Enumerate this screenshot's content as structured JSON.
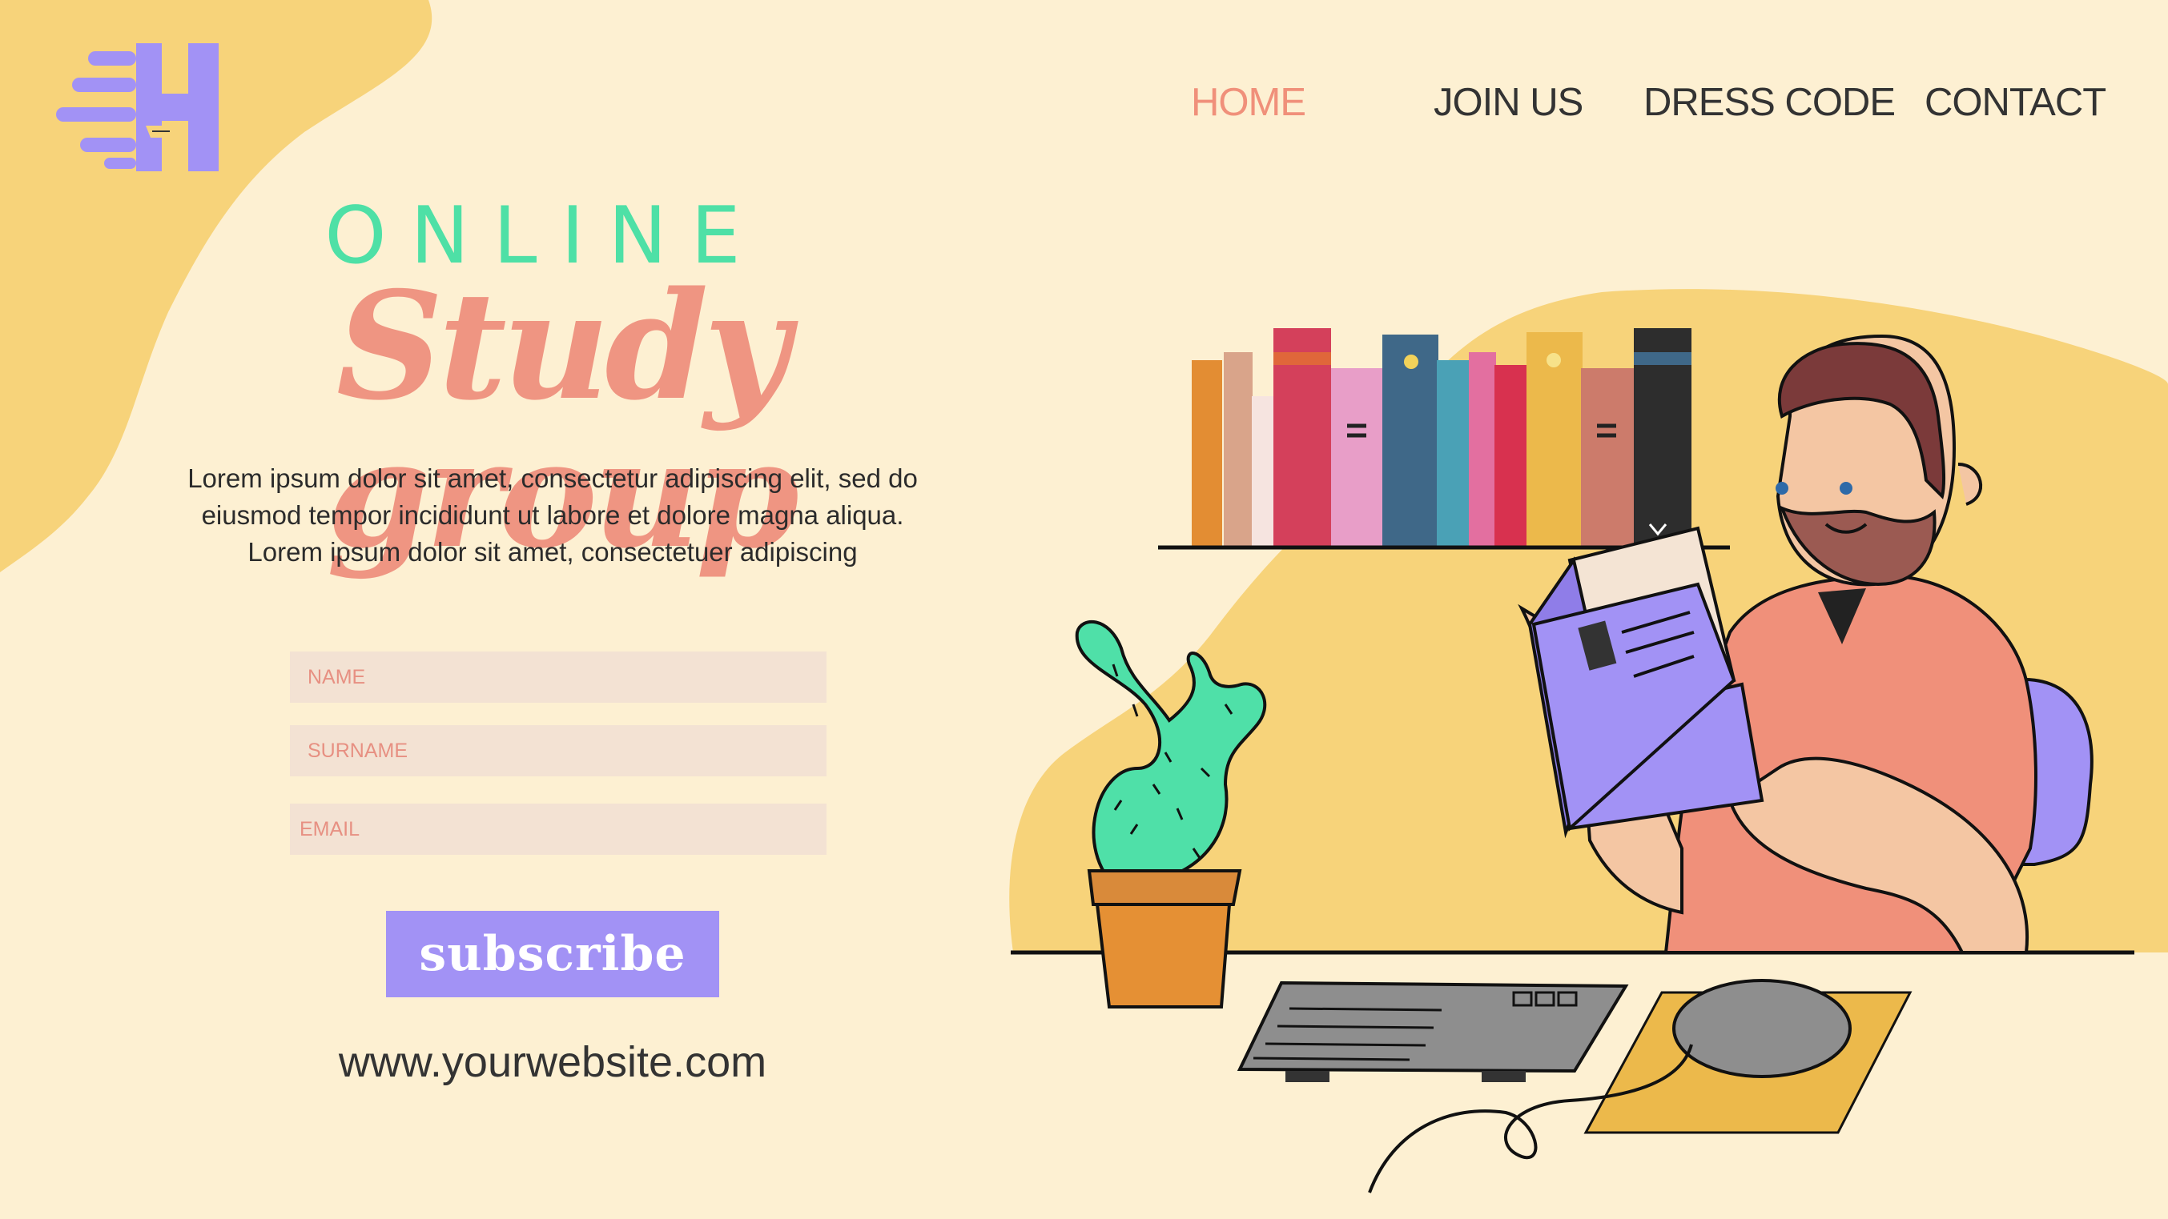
{
  "brand": {
    "logo_letter": "H",
    "logo_color": "#a292f5"
  },
  "nav": {
    "items": [
      {
        "label": "HOME",
        "active": true
      },
      {
        "label": "JOIN US",
        "active": false
      },
      {
        "label": "DRESS CODE",
        "active": false
      },
      {
        "label": "CONTACT",
        "active": false
      }
    ]
  },
  "hero": {
    "kicker": "ONLINE",
    "title": "Study group",
    "description": "Lorem ipsum dolor sit amet, consectetur adipiscing elit, sed do eiusmod tempor incididunt ut labore et dolore magna aliqua. Lorem ipsum dolor sit amet, consectetuer adipiscing"
  },
  "form": {
    "name_placeholder": "NAME",
    "surname_placeholder": "SURNAME",
    "email_placeholder": "EMAIL",
    "subscribe_label": "subscribe"
  },
  "footer": {
    "website": "www.yourwebsite.com"
  },
  "colors": {
    "background": "#fdf0d2",
    "blob": "#f7d37a",
    "accent_green": "#4ee0a6",
    "accent_salmon": "#ef9582",
    "accent_purple": "#a292f5",
    "text_dark": "#333333"
  },
  "illustration": {
    "subject": "man-reading-book-at-desk",
    "objects": [
      "bookshelf",
      "cactus-plant",
      "keyboard",
      "computer-mouse",
      "mouse-pad",
      "book"
    ]
  }
}
